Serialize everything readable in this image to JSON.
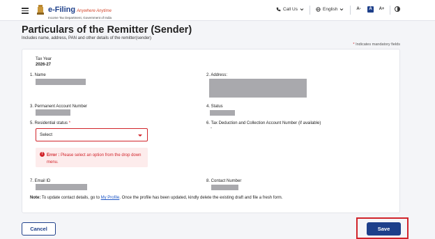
{
  "header": {
    "brand_main": "e-Filing",
    "brand_tagline": "Anywhere Anytime",
    "brand_sub": "Income Tax Department, Government of India",
    "call_us": "Call Us",
    "language": "English",
    "font_decrease": "A-",
    "font_normal": "A",
    "font_increase": "A+",
    "icons": [
      "menu-icon",
      "emblem-icon",
      "phone-icon",
      "chevron-down-icon",
      "globe-icon",
      "contrast-icon"
    ]
  },
  "page": {
    "title": "Particulars of the Remitter (Sender)",
    "subtitle": "Includes name, address, PAN and other details of the remitter(sender)",
    "mandatory_star": "*",
    "mandatory_note": "Indicates mandatory fields"
  },
  "form": {
    "tax_year_label": "Tax Year",
    "tax_year_value": "2026-27",
    "name_label": "1. Name",
    "address_label": "2. Address:",
    "pan_label": "3. Permanent Account Number",
    "status_label": "4. Status",
    "residential_label": "5. Residential status",
    "required_star": "*",
    "residential_value": "Select",
    "tan_label": "6. Tax Deduction and Collection Account Number (if available)",
    "tan_value": "-",
    "error_prefix": "Error :",
    "error_message": "Please select an option from the drop down menu.",
    "email_label": "7. Email ID",
    "contact_label": "8. Contact Number"
  },
  "note": {
    "prefix": "Note:",
    "before_link": "To update contact details, go to",
    "link": "My Profile",
    "after_link": ". Once the profile has been updated, kindly delete the existing draft and file a fresh form."
  },
  "actions": {
    "cancel": "Cancel",
    "save": "Save"
  },
  "colors": {
    "brand_blue": "#1d3f8a",
    "error_red": "#d1232a",
    "link_blue": "#1d56c6"
  }
}
